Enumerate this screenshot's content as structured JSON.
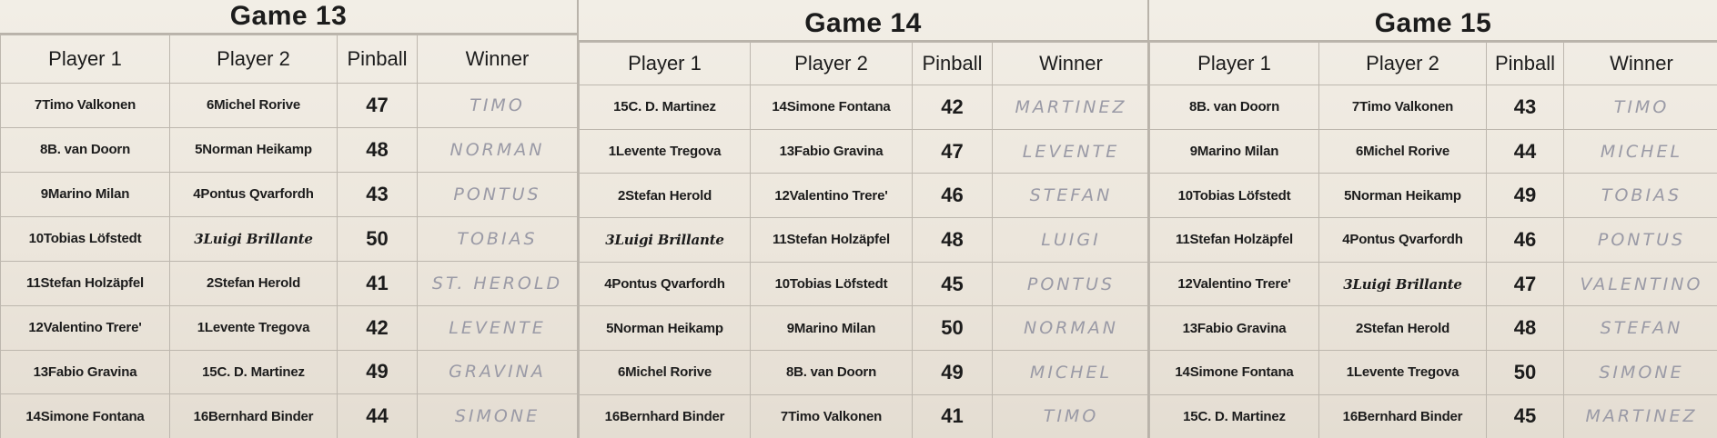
{
  "games": [
    {
      "title": "Game 13",
      "headers": [
        "Player 1",
        "Player 2",
        "Pinball",
        "Winner"
      ],
      "rows": [
        {
          "p1": "7Timo Valkonen",
          "p2": "6Michel Rorive",
          "pinball": "47",
          "winner": "TIMO"
        },
        {
          "p1": "8B. van Doorn",
          "p2": "5Norman Heikamp",
          "pinball": "48",
          "winner": "NORMAN"
        },
        {
          "p1": "9Marino Milan",
          "p2": "4Pontus Qvarfordh",
          "pinball": "43",
          "winner": "PONTUS"
        },
        {
          "p1": "10Tobias Löfstedt",
          "p2": "3Luigi Brillante",
          "pinball": "50",
          "winner": "TOBIAS"
        },
        {
          "p1": "11Stefan Holzäpfel",
          "p2": "2Stefan Herold",
          "pinball": "41",
          "winner": "ST. HEROLD"
        },
        {
          "p1": "12Valentino Trere'",
          "p2": "1Levente Tregova",
          "pinball": "42",
          "winner": "LEVENTE"
        },
        {
          "p1": "13Fabio Gravina",
          "p2": "15C. D. Martinez",
          "pinball": "49",
          "winner": "GRAVINA"
        },
        {
          "p1": "14Simone Fontana",
          "p2": "16Bernhard Binder",
          "pinball": "44",
          "winner": "SIMONE"
        }
      ]
    },
    {
      "title": "Game 14",
      "headers": [
        "Player 1",
        "Player 2",
        "Pinball",
        "Winner"
      ],
      "rows": [
        {
          "p1": "15C. D. Martinez",
          "p2": "14Simone Fontana",
          "pinball": "42",
          "winner": "MARTINEZ"
        },
        {
          "p1": "1Levente Tregova",
          "p2": "13Fabio Gravina",
          "pinball": "47",
          "winner": "LEVENTE"
        },
        {
          "p1": "2Stefan Herold",
          "p2": "12Valentino Trere'",
          "pinball": "46",
          "winner": "STEFAN"
        },
        {
          "p1": "3Luigi Brillante",
          "p2": "11Stefan Holzäpfel",
          "pinball": "48",
          "winner": "LUIGI"
        },
        {
          "p1": "4Pontus Qvarfordh",
          "p2": "10Tobias Löfstedt",
          "pinball": "45",
          "winner": "PONTUS"
        },
        {
          "p1": "5Norman Heikamp",
          "p2": "9Marino Milan",
          "pinball": "50",
          "winner": "NORMAN"
        },
        {
          "p1": "6Michel Rorive",
          "p2": "8B. van Doorn",
          "pinball": "49",
          "winner": "MICHEL"
        },
        {
          "p1": "16Bernhard Binder",
          "p2": "7Timo Valkonen",
          "pinball": "41",
          "winner": "TIMO"
        }
      ]
    },
    {
      "title": "Game 15",
      "headers": [
        "Player 1",
        "Player 2",
        "Pinball",
        "Winner"
      ],
      "rows": [
        {
          "p1": "8B. van Doorn",
          "p2": "7Timo Valkonen",
          "pinball": "43",
          "winner": "TIMO"
        },
        {
          "p1": "9Marino Milan",
          "p2": "6Michel Rorive",
          "pinball": "44",
          "winner": "MICHEL"
        },
        {
          "p1": "10Tobias Löfstedt",
          "p2": "5Norman Heikamp",
          "pinball": "49",
          "winner": "TOBIAS"
        },
        {
          "p1": "11Stefan Holzäpfel",
          "p2": "4Pontus Qvarfordh",
          "pinball": "46",
          "winner": "PONTUS"
        },
        {
          "p1": "12Valentino Trere'",
          "p2": "3Luigi Brillante",
          "pinball": "47",
          "winner": "VALENTINO"
        },
        {
          "p1": "13Fabio Gravina",
          "p2": "2Stefan Herold",
          "pinball": "48",
          "winner": "STEFAN"
        },
        {
          "p1": "14Simone Fontana",
          "p2": "1Levente Tregova",
          "pinball": "50",
          "winner": "SIMONE"
        },
        {
          "p1": "15C. D. Martinez",
          "p2": "16Bernhard Binder",
          "pinball": "45",
          "winner": "MARTINEZ"
        }
      ]
    }
  ]
}
